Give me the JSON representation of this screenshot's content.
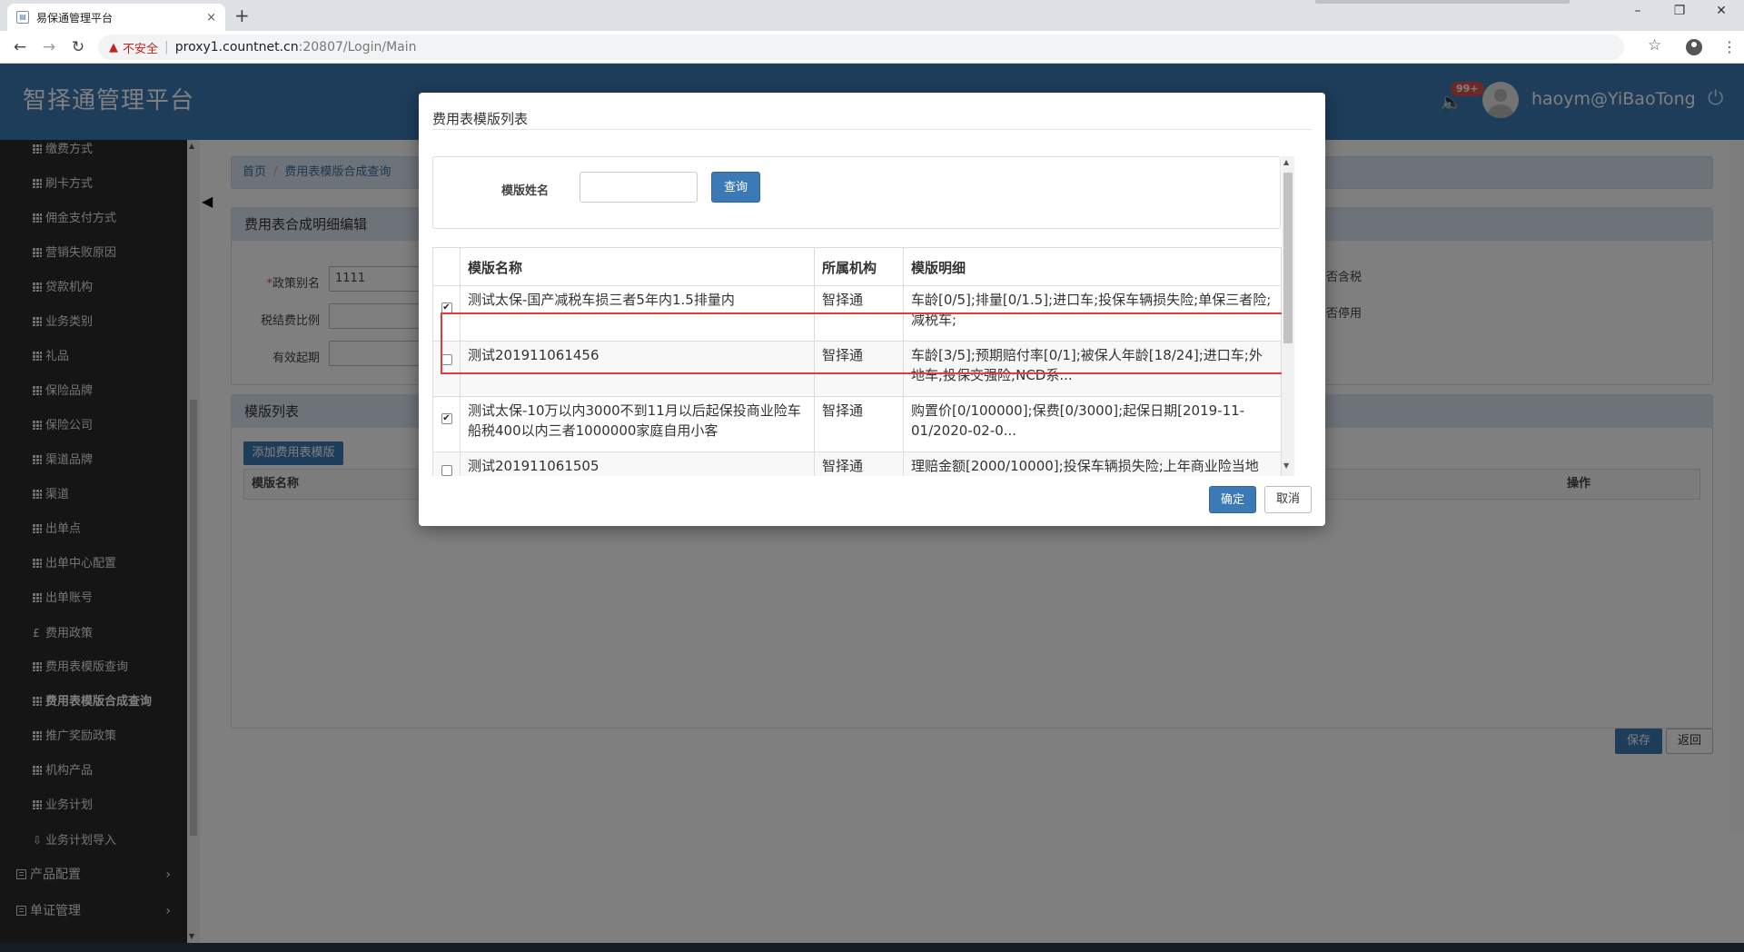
{
  "browser": {
    "tab_title": "易保通管理平台",
    "tab_close": "×",
    "new_tab": "+",
    "win_min": "–",
    "win_max": "❐",
    "win_close": "✕",
    "back": "←",
    "forward": "→",
    "reload": "↻",
    "insecure_label": "不安全",
    "url_host": "proxy1.countnet.cn",
    "url_path": ":20807/Login/Main",
    "bookmark": "☆",
    "menu": "⋮"
  },
  "header": {
    "brand": "智择通管理平台",
    "speaker_icon": "🔈",
    "notification_count": "99+",
    "username": "haoym@YiBaoTong",
    "power_icon": "⏻"
  },
  "sidebar": {
    "items": [
      {
        "label": "缴费方式",
        "icon": "grid-icon"
      },
      {
        "label": "刷卡方式",
        "icon": "grid-icon"
      },
      {
        "label": "佣金支付方式",
        "icon": "grid-icon"
      },
      {
        "label": "营销失败原因",
        "icon": "grid-icon"
      },
      {
        "label": "贷款机构",
        "icon": "grid-icon"
      },
      {
        "label": "业务类别",
        "icon": "grid-icon"
      },
      {
        "label": "礼品",
        "icon": "grid-icon"
      },
      {
        "label": "保险品牌",
        "icon": "grid-icon"
      },
      {
        "label": "保险公司",
        "icon": "grid-icon"
      },
      {
        "label": "渠道品牌",
        "icon": "grid-icon"
      },
      {
        "label": "渠道",
        "icon": "grid-icon"
      },
      {
        "label": "出单点",
        "icon": "grid-icon"
      },
      {
        "label": "出单中心配置",
        "icon": "grid-icon"
      },
      {
        "label": "出单账号",
        "icon": "grid-icon"
      },
      {
        "label": "费用政策",
        "icon": "pound-icon",
        "symbol": "£"
      },
      {
        "label": "费用表模版查询",
        "icon": "grid-icon"
      },
      {
        "label": "费用表模版合成查询",
        "icon": "grid-icon",
        "active": true
      },
      {
        "label": "推广奖励政策",
        "icon": "grid-icon"
      },
      {
        "label": "机构产品",
        "icon": "grid-icon"
      },
      {
        "label": "业务计划",
        "icon": "grid-icon"
      },
      {
        "label": "业务计划导入",
        "icon": "import-icon",
        "symbol": "⇩"
      }
    ],
    "groups": [
      {
        "label": "产品配置",
        "chevron": "›"
      },
      {
        "label": "单证管理",
        "chevron": "›"
      }
    ]
  },
  "breadcrumb": {
    "home": "首页",
    "current": "费用表模版合成查询"
  },
  "edit_panel": {
    "title": "费用表合成明细编辑",
    "alias_label": "政策别名",
    "alias_required": "*",
    "alias_value": "1111",
    "tax_ratio_label": "税结费比例",
    "valid_from_label": "有效起期",
    "tax_included_label": "否含税",
    "disabled_label": "否停用"
  },
  "template_panel": {
    "title": "模版列表",
    "add_button": "添加费用表模版",
    "col_name": "模版名称",
    "col_action": "操作"
  },
  "page_actions": {
    "save": "保存",
    "back": "返回"
  },
  "collapse_icon": "◀",
  "modal": {
    "title": "费用表模版列表",
    "search_label": "模版姓名",
    "search_value": "",
    "search_button": "查询",
    "columns": [
      "模版名称",
      "所属机构",
      "模版明细"
    ],
    "rows": [
      {
        "checked": true,
        "name": "测试太保-国产减税车损三者5年内1.5排量内",
        "org": "智择通",
        "detail": "车龄[0/5];排量[0/1.5];进口车;投保车辆损失险;单保三者险;减税车;"
      },
      {
        "checked": false,
        "name": "测试201911061456",
        "org": "智择通",
        "detail": "车龄[3/5];预期赔付率[0/1];被保人年龄[18/24];进口车;外地车;投保交强险;NCD系..."
      },
      {
        "checked": true,
        "name": "测试太保-10万以内3000不到11月以后起保投商业险车船税400以内三者1000000家庭自用小客",
        "org": "智择通",
        "detail": "购置价[0/100000];保费[0/3000];起保日期[2019-11-01/2020-02-0..."
      },
      {
        "checked": false,
        "name": "测试201911061505",
        "org": "智择通",
        "detail": "理赔金额[2000/10000];投保车辆损失险;上年商业险当地"
      }
    ],
    "ok_button": "确定",
    "cancel_button": "取消",
    "check_mark": "✔"
  }
}
